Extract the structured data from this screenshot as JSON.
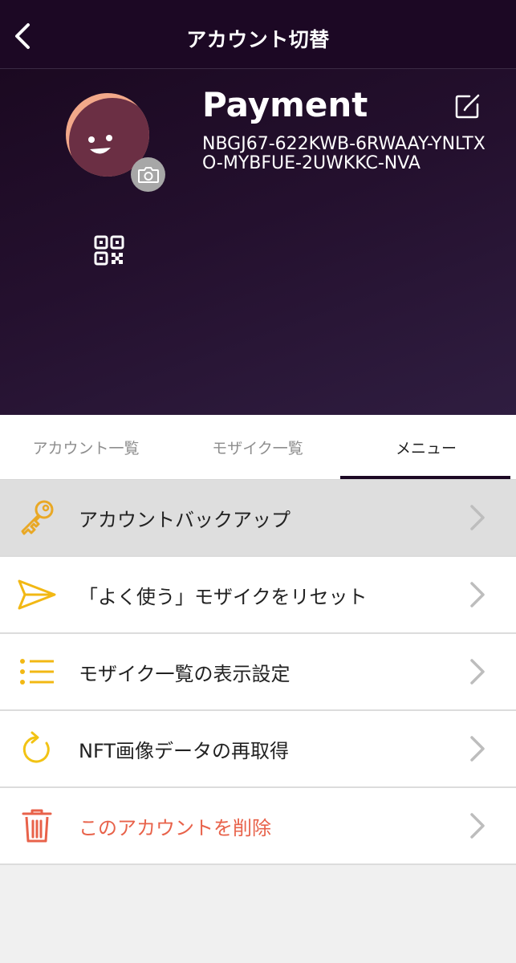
{
  "header": {
    "title": "アカウント切替"
  },
  "profile": {
    "name": "Payment",
    "address": "NBGJ67-622KWB-6RWAAY-YNLTXO-MYBFUE-2UWKKC-NVA"
  },
  "tabs": [
    {
      "label": "アカウント一覧",
      "active": false
    },
    {
      "label": "モザイク一覧",
      "active": false
    },
    {
      "label": "メニュー",
      "active": true
    }
  ],
  "menu": [
    {
      "label": "アカウントバックアップ",
      "icon": "key-icon",
      "color": "#e9a825"
    },
    {
      "label": "「よく使う」モザイクをリセット",
      "icon": "send-icon",
      "color": "#f2b814"
    },
    {
      "label": "モザイク一覧の表示設定",
      "icon": "list-icon",
      "color": "#f2b814"
    },
    {
      "label": "NFT画像データの再取得",
      "icon": "refresh-icon",
      "color": "#f2c314"
    },
    {
      "label": "このアカウントを削除",
      "icon": "trash-icon",
      "color": "#e8624a"
    }
  ],
  "colors": {
    "header_bg": "#1c0824",
    "accent_yellow": "#f2b814",
    "danger": "#e8624a",
    "avatar_face": "#6b2f44",
    "avatar_hair": "#f2a88a"
  }
}
